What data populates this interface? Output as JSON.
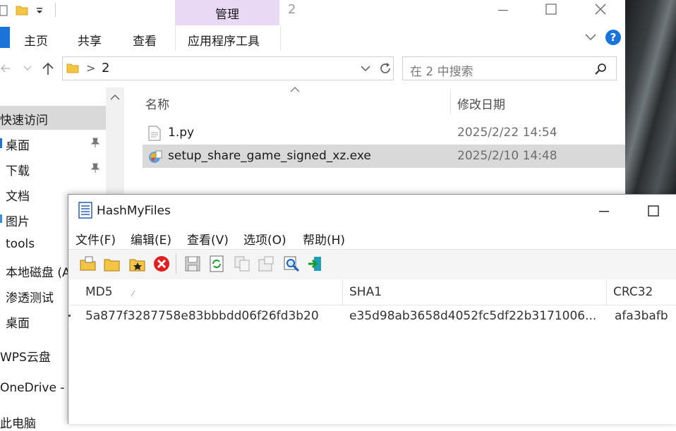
{
  "explorer": {
    "window_title": "2",
    "contextual_tab": "管理",
    "ribbon_tabs": [
      "主页",
      "共享",
      "查看",
      "应用程序工具"
    ],
    "address": {
      "separator": ">",
      "current_folder": "2"
    },
    "search_placeholder": "在 2 中搜索",
    "nav_items": [
      {
        "label": "快速访问",
        "selected": true
      },
      {
        "label": "桌面",
        "pinned": true
      },
      {
        "label": "下载",
        "pinned": true
      },
      {
        "label": "文档",
        "pinned": true
      },
      {
        "label": "图片"
      },
      {
        "label": "tools"
      },
      {
        "label": "本地磁盘 (A"
      },
      {
        "label": "渗透测试"
      },
      {
        "label": "桌面"
      },
      {
        "label": "WPS云盘"
      },
      {
        "label": "OneDrive -"
      },
      {
        "label": "此电脑"
      }
    ],
    "columns": {
      "name": "名称",
      "date": "修改日期"
    },
    "files": [
      {
        "name": "1.py",
        "date": "2025/2/22 14:54",
        "icon": "text-file-icon"
      },
      {
        "name": "setup_share_game_signed_xz.exe",
        "date": "2025/2/10 14:48",
        "icon": "installer-icon",
        "selected": true
      }
    ]
  },
  "hashmyfiles": {
    "title": "HashMyFiles",
    "menu": [
      "文件(F)",
      "编辑(E)",
      "查看(V)",
      "选项(O)",
      "帮助(H)"
    ],
    "toolbar_icons": [
      "open-files-icon",
      "open-folder-icon",
      "add-file-icon",
      "delete-icon",
      "save-icon",
      "refresh-icon",
      "copy-icon",
      "properties-icon",
      "find-icon",
      "exit-icon"
    ],
    "columns": [
      "MD5",
      "SHA1",
      "CRC32"
    ],
    "rows": [
      {
        "md5": "5a877f3287758e83bbbdd06f26fd3b20",
        "sha1": "e35d98ab3658d4052fc5df22b3171006...",
        "crc32": "afa3bafb"
      }
    ]
  },
  "colors": {
    "manage_tab": "#ead9f5",
    "accent_blue": "#1a73d9",
    "selection": "#d9d9d9",
    "delete_red": "#e02020"
  }
}
